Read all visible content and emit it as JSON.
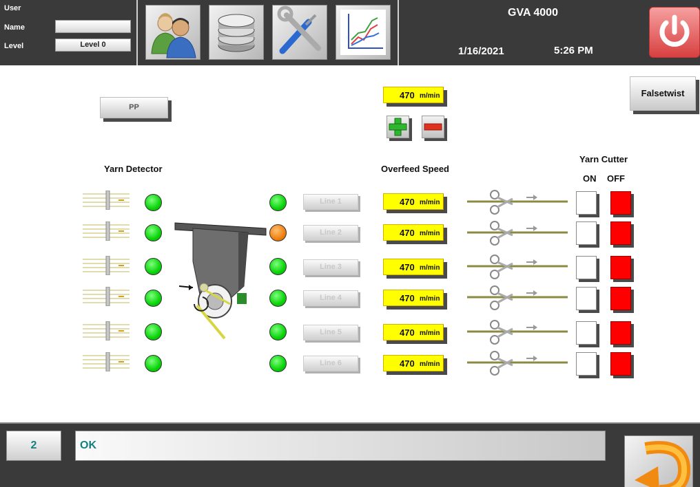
{
  "header": {
    "user_label": "User",
    "name_label": "Name",
    "name_value": "",
    "level_label": "Level",
    "level_value": "Level 0",
    "app_title": "GVA 4000",
    "date": "1/16/2021",
    "time": "5:26 PM",
    "icons": [
      "users-icon",
      "database-icon",
      "tools-icon",
      "chart-icon"
    ]
  },
  "main": {
    "pp_button": "PP",
    "falsetwist_button": "Falsetwist",
    "master_speed": {
      "value": "470",
      "unit": "m/min"
    },
    "yarn_detector_title": "Yarn Detector",
    "overfeed_title": "Overfeed Speed",
    "yarn_cutter_title": "Yarn Cutter",
    "cutter_on_label": "ON",
    "cutter_off_label": "OFF",
    "lines": [
      {
        "label": "Line 1",
        "speed": "470",
        "unit": "m/min",
        "status": "green"
      },
      {
        "label": "Line 2",
        "speed": "470",
        "unit": "m/min",
        "status": "orange"
      },
      {
        "label": "Line 3",
        "speed": "470",
        "unit": "m/min",
        "status": "green"
      },
      {
        "label": "Line 4",
        "speed": "470",
        "unit": "m/min",
        "status": "green"
      },
      {
        "label": "Line 5",
        "speed": "470",
        "unit": "m/min",
        "status": "green"
      },
      {
        "label": "Line 6",
        "speed": "470",
        "unit": "m/min",
        "status": "green"
      }
    ]
  },
  "footer": {
    "message_number": "2",
    "message_text": "OK"
  },
  "colors": {
    "header_bg": "#3a3a3a",
    "speed_bg": "#ffff00",
    "led_green": "#0ad40a",
    "led_orange": "#f08010",
    "cutter_off": "#ff0000",
    "message_text": "#128080"
  }
}
